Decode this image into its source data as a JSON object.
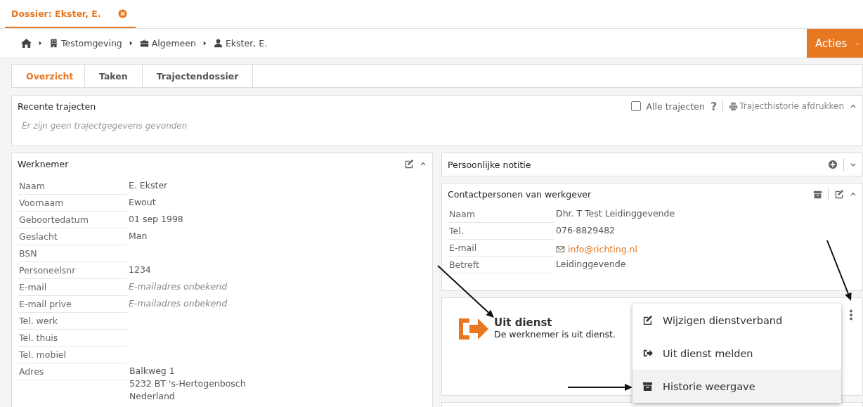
{
  "dossier_tab": {
    "title": "Dossier: Ekster, E.",
    "selected": true
  },
  "breadcrumb": [
    {
      "kind": "home"
    },
    {
      "kind": "building",
      "label": "Testomgeving"
    },
    {
      "kind": "briefcase",
      "label": "Algemeen"
    },
    {
      "kind": "user",
      "label": "Ekster, E."
    }
  ],
  "actions_button": {
    "label": "Acties"
  },
  "tabs": [
    {
      "label": "Overzicht",
      "selected": true
    },
    {
      "label": "Taken",
      "selected": false
    },
    {
      "label": "Trajectendossier",
      "selected": false
    }
  ],
  "recent": {
    "title": "Recente trajecten",
    "checkbox_label": "Alle trajecten",
    "checked": false,
    "help": "?",
    "print_label": "Trajecthistorie afdrukken",
    "empty_text": "Er zijn geen trajectgegevens gevonden"
  },
  "employee": {
    "title": "Werknemer",
    "fields": [
      {
        "label": "Naam",
        "value": "E. Ekster"
      },
      {
        "label": "Voornaam",
        "value": "Ewout"
      },
      {
        "label": "Geboortedatum",
        "value": "01 sep 1998"
      },
      {
        "label": "Geslacht",
        "value": "Man"
      },
      {
        "label": "BSN"
      },
      {
        "label": "Personeelsnr",
        "value": "1234"
      },
      {
        "label": "E-mail",
        "value": "E-mailadres onbekend",
        "unknown": true
      },
      {
        "label": "E-mail prive",
        "value": "E-mailadres onbekend",
        "unknown": true
      },
      {
        "label": "Tel. werk"
      },
      {
        "label": "Tel. thuis"
      },
      {
        "label": "Tel. mobiel"
      },
      {
        "label": "Adres",
        "lines": [
          "Balkweg 1",
          "5232 BT 's-Hertogenbosch",
          "Nederland"
        ]
      }
    ]
  },
  "note": {
    "title": "Persoonlijke notitie"
  },
  "contacts": {
    "title": "Contactpersonen van werkgever",
    "fields": [
      {
        "label": "Naam",
        "value": "Dhr. T Test Leidinggevende"
      },
      {
        "label": "Tel.",
        "value": "076-8829482"
      },
      {
        "label": "E-mail",
        "value": "info@richting.nl",
        "kind": "email"
      },
      {
        "label": "Betreft",
        "value": "Leidinggevende"
      }
    ]
  },
  "status": {
    "title": "Uit dienst",
    "text": "De werknemer is uit dienst."
  },
  "menu": [
    {
      "kind": "edit",
      "label": "Wijzigen dienstverband",
      "selected": false
    },
    {
      "kind": "exit",
      "label": "Uit dienst melden",
      "selected": false
    },
    {
      "kind": "archive",
      "label": "Historie weergave",
      "selected": true
    }
  ]
}
